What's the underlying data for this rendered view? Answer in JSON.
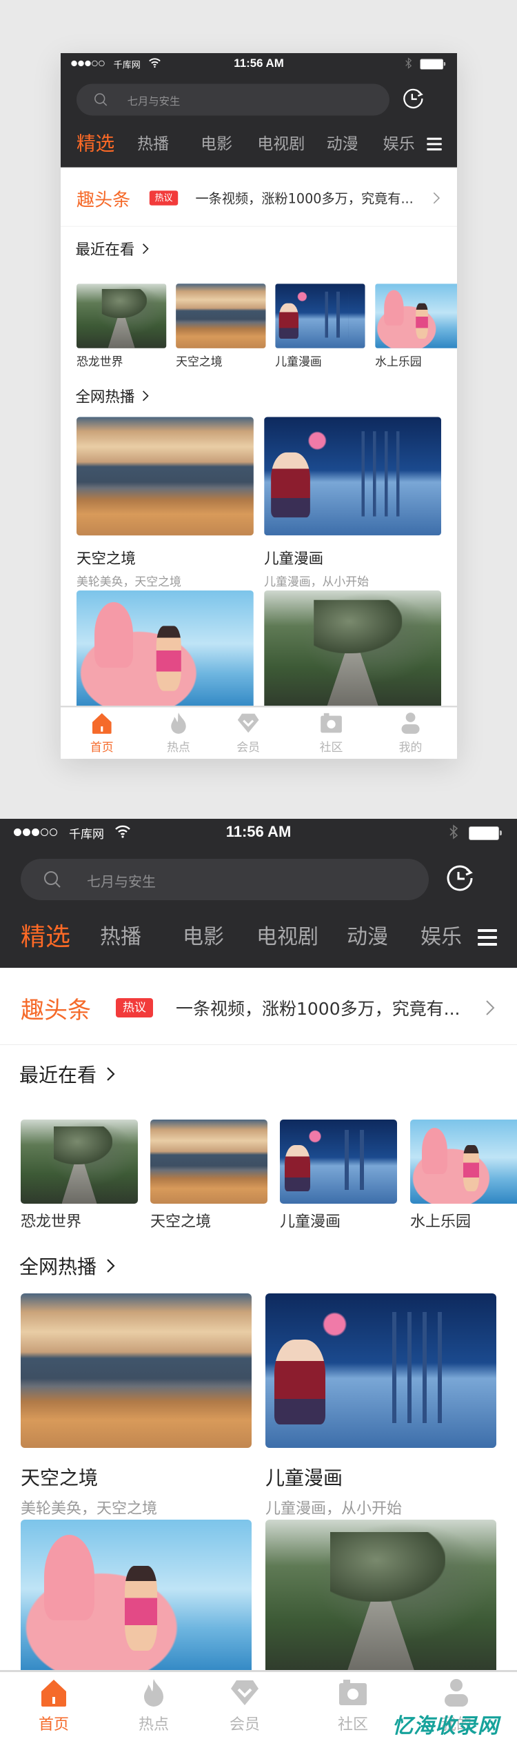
{
  "status_bar": {
    "carrier": "千库网",
    "time": "11:56 AM",
    "signal_bars_filled": 3,
    "signal_bars_total": 5
  },
  "search": {
    "placeholder": "七月与安生"
  },
  "tabs": [
    {
      "label": "精选",
      "active": true
    },
    {
      "label": "热播",
      "active": false
    },
    {
      "label": "电影",
      "active": false
    },
    {
      "label": "电视剧",
      "active": false
    },
    {
      "label": "动漫",
      "active": false
    },
    {
      "label": "娱乐",
      "active": false
    }
  ],
  "headline": {
    "brand": "趣头条",
    "badge": "热议",
    "text": "一条视频，涨粉1000多万，究竟有..."
  },
  "recent": {
    "title": "最近在看",
    "items": [
      {
        "label": "恐龙世界",
        "image": "dinosaur-road"
      },
      {
        "label": "天空之境",
        "image": "sky-mirror-lake"
      },
      {
        "label": "儿童漫画",
        "image": "boy-storybook"
      },
      {
        "label": "水上乐园",
        "image": "girl-flamingo-float"
      }
    ]
  },
  "hot": {
    "title": "全网热播",
    "items": [
      {
        "title": "天空之境",
        "subtitle": "美轮美奂，天空之境",
        "image": "sky-mirror-lake"
      },
      {
        "title": "儿童漫画",
        "subtitle": "儿童漫画，从小开始",
        "image": "boy-storybook"
      },
      {
        "title": "",
        "subtitle": "",
        "image": "girl-flamingo-float"
      },
      {
        "title": "",
        "subtitle": "",
        "image": "dinosaur-road"
      }
    ]
  },
  "bottom_nav": [
    {
      "label": "首页",
      "icon": "home-icon",
      "active": true
    },
    {
      "label": "热点",
      "icon": "flame-icon",
      "active": false
    },
    {
      "label": "会员",
      "icon": "diamond-icon",
      "active": false
    },
    {
      "label": "社区",
      "icon": "camera-icon",
      "active": false
    },
    {
      "label": "我的",
      "icon": "user-icon",
      "active": false
    }
  ],
  "colors": {
    "accent": "#f56a2a",
    "badge": "#f23b3b",
    "header_bg": "#2b2b2d",
    "inactive": "#b5b5b5"
  },
  "watermark": "忆海收录网"
}
